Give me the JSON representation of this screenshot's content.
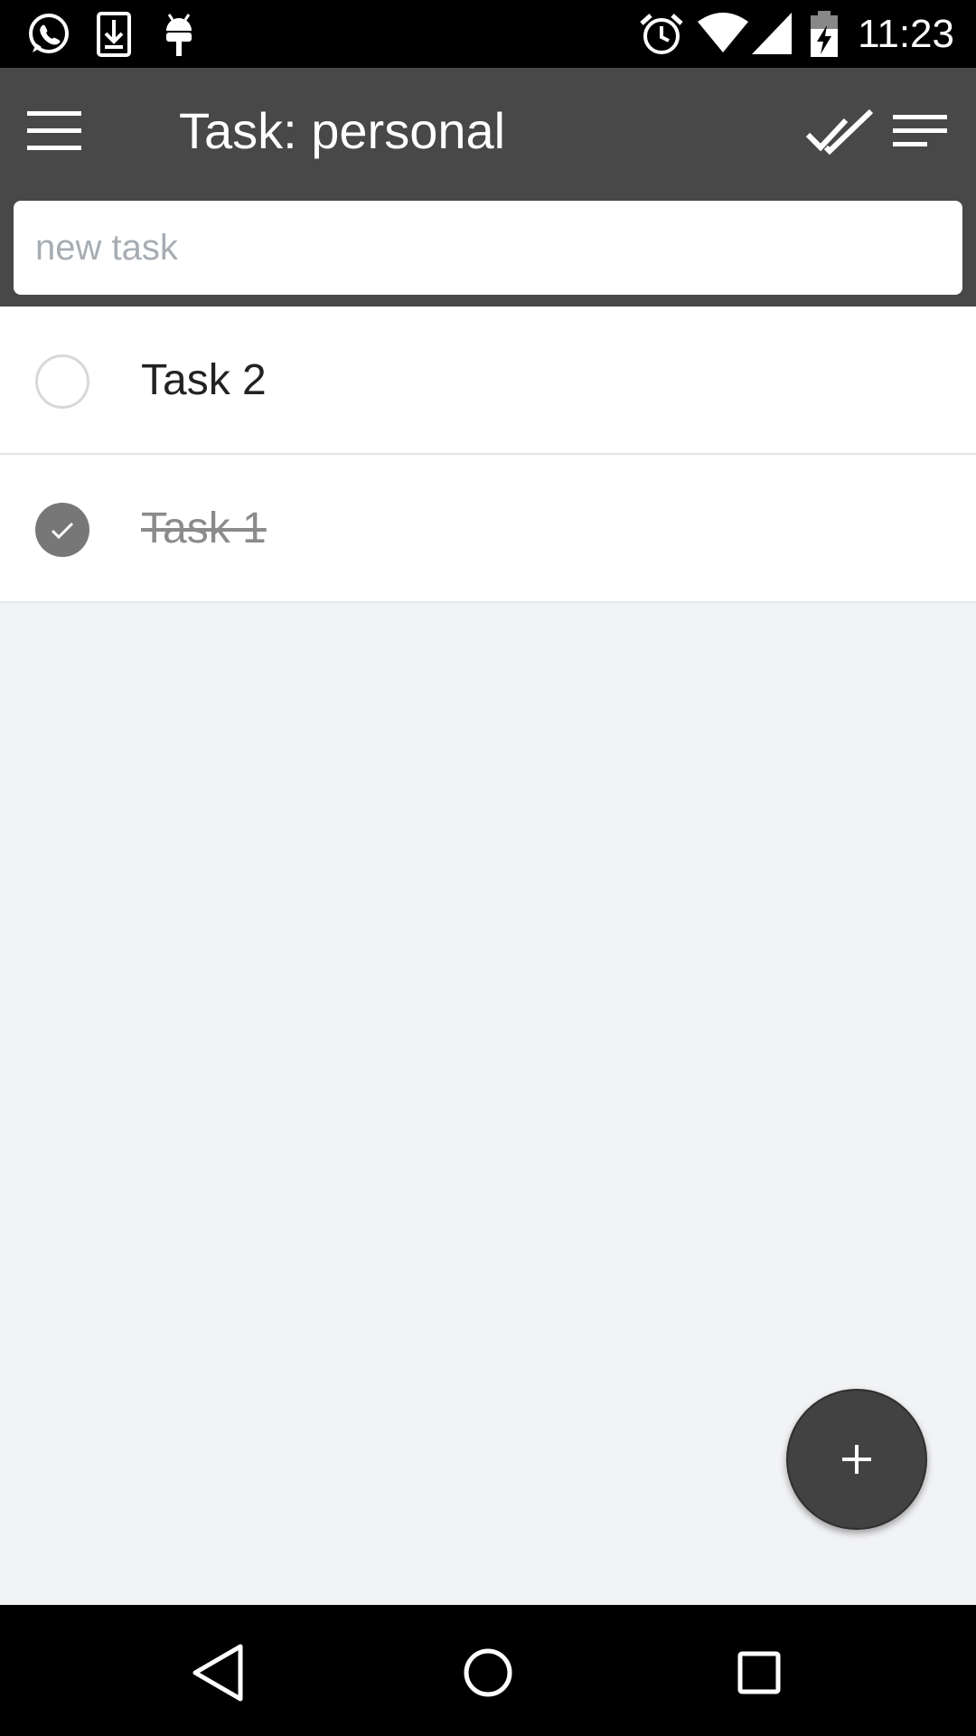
{
  "status_bar": {
    "time": "11:23",
    "left_icons": [
      "whatsapp-icon",
      "download-icon",
      "android-debug-icon"
    ],
    "right_icons": [
      "alarm-icon",
      "wifi-icon",
      "signal-icon",
      "battery-charging-icon"
    ]
  },
  "app_bar": {
    "title": "Task: personal",
    "menu_icon": "hamburger-menu-icon",
    "actions": [
      "done-all-icon",
      "sort-icon"
    ],
    "background": "#484848"
  },
  "new_task": {
    "placeholder": "new task",
    "value": ""
  },
  "tasks": [
    {
      "label": "Task 2",
      "done": false
    },
    {
      "label": "Task 1",
      "done": true
    }
  ],
  "fab": {
    "label": "+",
    "background": "#424242"
  },
  "nav_bar": {
    "buttons": [
      "back-icon",
      "home-icon",
      "recents-icon"
    ]
  },
  "colors": {
    "content_background": "#f2f3f5",
    "done_check": "#777777",
    "done_text": "#8b8b8b"
  }
}
